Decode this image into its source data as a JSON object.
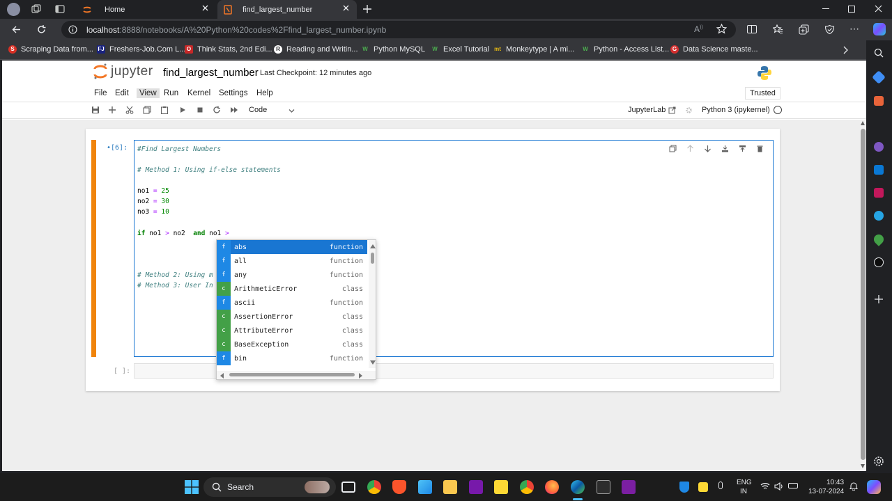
{
  "browser": {
    "tabs": [
      {
        "title": "Home"
      },
      {
        "title": "find_largest_number"
      }
    ],
    "url_host": "localhost",
    "url_path": ":8888/notebooks/A%20Python%20codes%2Ffind_largest_number.ipynb",
    "bookmarks": [
      {
        "label": "Scraping Data from...",
        "icon": "S",
        "color": "#d93025"
      },
      {
        "label": "Freshers-Job.Com L...",
        "icon": "FJ",
        "color": "#1a237e"
      },
      {
        "label": "Think Stats, 2nd Edi...",
        "icon": "O",
        "color": "#c62828"
      },
      {
        "label": "Reading and Writin...",
        "icon": "R",
        "color": "#ffffff"
      },
      {
        "label": "Python MySQL",
        "icon": "W",
        "color": "#2e7d32"
      },
      {
        "label": "Excel Tutorial",
        "icon": "W",
        "color": "#2e7d32"
      },
      {
        "label": "Monkeytype | A mi...",
        "icon": "mt",
        "color": "#e2b714"
      },
      {
        "label": "Python - Access List...",
        "icon": "W",
        "color": "#2e7d32"
      },
      {
        "label": "Data Science maste...",
        "icon": "G",
        "color": "#d32f2f"
      }
    ]
  },
  "jupyter": {
    "logo_text": "jupyter",
    "notebook_name": "find_largest_number",
    "checkpoint": "Last Checkpoint: 12 minutes ago",
    "menu": [
      "File",
      "Edit",
      "View",
      "Run",
      "Kernel",
      "Settings",
      "Help"
    ],
    "trusted": "Trusted",
    "cell_type": "Code",
    "jupyterlab_link": "JupyterLab",
    "kernel": "Python 3 (ipykernel)"
  },
  "cell1": {
    "prompt": "•[6]:",
    "lines": {
      "l1": "#Find Largest Numbers",
      "l2": "# Method 1: Using if-else statements",
      "l3a": "no1",
      "l3b": "=",
      "l3c": "25",
      "l4a": "no2",
      "l4b": "=",
      "l4c": "30",
      "l5a": "no3",
      "l5b": "=",
      "l5c": "10",
      "l6a": "if",
      "l6b": "no1",
      "l6c": ">",
      "l6d": "no2",
      "l6e": "and",
      "l6f": "no1",
      "l6g": ">",
      "l7": "# Method 2: Using m",
      "l8": "# Method 3: User In"
    }
  },
  "cell2": {
    "prompt": "[ ]:"
  },
  "completer": {
    "items": [
      {
        "type": "f",
        "name": "abs",
        "kind": "function"
      },
      {
        "type": "f",
        "name": "all",
        "kind": "function"
      },
      {
        "type": "f",
        "name": "any",
        "kind": "function"
      },
      {
        "type": "c",
        "name": "ArithmeticError",
        "kind": "class"
      },
      {
        "type": "f",
        "name": "ascii",
        "kind": "function"
      },
      {
        "type": "c",
        "name": "AssertionError",
        "kind": "class"
      },
      {
        "type": "c",
        "name": "AttributeError",
        "kind": "class"
      },
      {
        "type": "c",
        "name": "BaseException",
        "kind": "class"
      },
      {
        "type": "f",
        "name": "bin",
        "kind": "function"
      }
    ],
    "colors": {
      "function": "#1e88e5",
      "class": "#43a047"
    }
  },
  "taskbar": {
    "search_label": "Search",
    "lang": "ENG",
    "region": "IN",
    "time": "10:43",
    "date": "13-07-2024"
  }
}
